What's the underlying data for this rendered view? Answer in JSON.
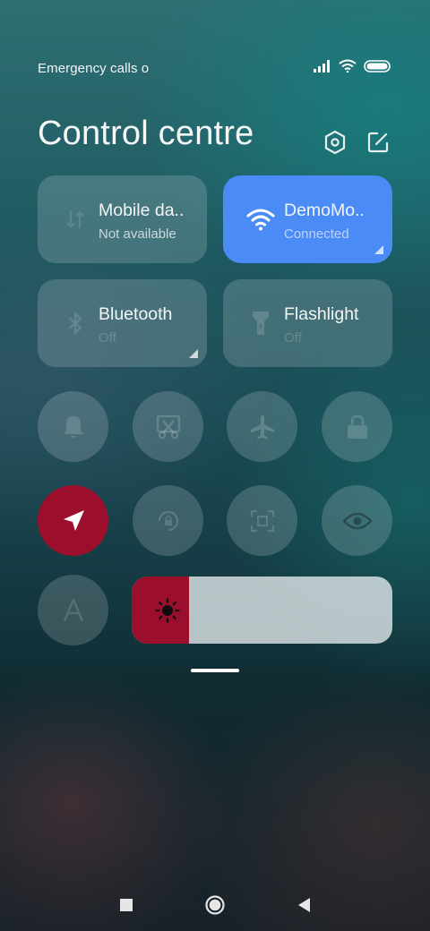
{
  "status_bar": {
    "carrier_text": "Emergency calls o",
    "icons": [
      "signal-icon",
      "wifi-icon",
      "battery-icon"
    ]
  },
  "header": {
    "title": "Control centre",
    "actions": [
      "settings-icon",
      "edit-icon"
    ]
  },
  "tiles": [
    {
      "name": "mobile-data",
      "title": "Mobile da..",
      "subtitle": "Not available",
      "active": false,
      "icon": "mobile-data-icon"
    },
    {
      "name": "wifi",
      "title": "DemoMo..",
      "subtitle": "Connected",
      "active": true,
      "icon": "wifi-icon"
    },
    {
      "name": "bluetooth",
      "title": "Bluetooth",
      "subtitle": "Off",
      "active": false,
      "icon": "bluetooth-icon"
    },
    {
      "name": "flashlight",
      "title": "Flashlight",
      "subtitle": "Off",
      "active": false,
      "icon": "flashlight-icon"
    }
  ],
  "toggles": [
    {
      "name": "silent",
      "icon": "bell-icon",
      "on": false
    },
    {
      "name": "screenshot",
      "icon": "scissors-screenshot-icon",
      "on": false
    },
    {
      "name": "airplane-mode",
      "icon": "airplane-icon",
      "on": false
    },
    {
      "name": "lock-screen",
      "icon": "lock-icon",
      "on": false
    },
    {
      "name": "location",
      "icon": "location-arrow-icon",
      "on": true
    },
    {
      "name": "rotation-lock",
      "icon": "rotation-lock-icon",
      "on": false
    },
    {
      "name": "scanner",
      "icon": "scan-icon",
      "on": false
    },
    {
      "name": "reading-mode",
      "icon": "eye-icon",
      "on": false
    },
    {
      "name": "auto-brightness",
      "icon": "auto-brightness-icon",
      "on": false
    }
  ],
  "brightness": {
    "level": 0.22,
    "icon": "sun-icon"
  },
  "colors": {
    "accent_blue": "#4a8bf6",
    "active_red": "#9b0f2d"
  },
  "nav_bar": [
    "recents-icon",
    "home-icon",
    "back-icon"
  ]
}
